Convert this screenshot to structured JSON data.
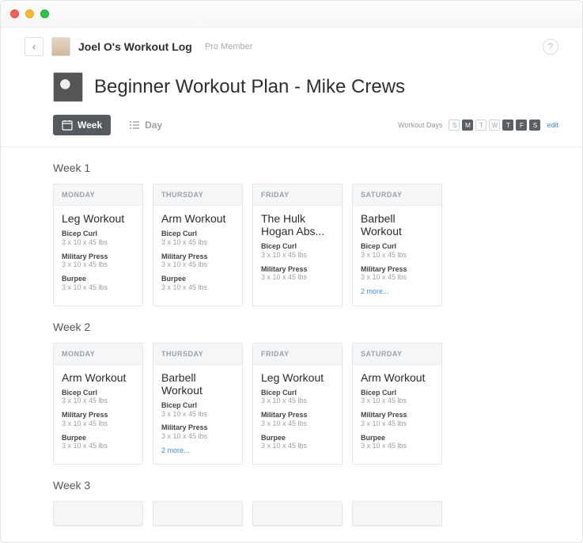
{
  "window": {
    "traffic_lights": [
      "red",
      "yellow",
      "green"
    ]
  },
  "header": {
    "back_glyph": "‹",
    "title": "Joel O's Workout Log",
    "subtitle": "Pro Member",
    "help_glyph": "?"
  },
  "plan": {
    "title": "Beginner Workout Plan - Mike Crews"
  },
  "toolbar": {
    "week_label": "Week",
    "day_label": "Day",
    "workout_days_label": "Workout Days",
    "edit_label": "edit",
    "days": [
      {
        "letter": "S",
        "on": false
      },
      {
        "letter": "M",
        "on": true
      },
      {
        "letter": "T",
        "on": false
      },
      {
        "letter": "W",
        "on": false
      },
      {
        "letter": "T",
        "on": true
      },
      {
        "letter": "F",
        "on": true
      },
      {
        "letter": "S",
        "on": true
      }
    ]
  },
  "weeks": [
    {
      "label": "Week 1",
      "cards": [
        {
          "day": "MONDAY",
          "title": "Leg Workout",
          "exercises": [
            {
              "name": "Bicep Curl",
              "sets": "3 x 10 x 45 lbs"
            },
            {
              "name": "Military Press",
              "sets": "3 x 10 x 45 lbs"
            },
            {
              "name": "Burpee",
              "sets": "3 x 10 x 45 lbs"
            }
          ],
          "more": null
        },
        {
          "day": "THURSDAY",
          "title": "Arm Workout",
          "exercises": [
            {
              "name": "Bicep Curl",
              "sets": "3 x 10 x 45 lbs"
            },
            {
              "name": "Military Press",
              "sets": "3 x 10 x 45 lbs"
            },
            {
              "name": "Burpee",
              "sets": "3 x 10 x 45 lbs"
            }
          ],
          "more": null
        },
        {
          "day": "FRIDAY",
          "title": "The Hulk Hogan Abs...",
          "exercises": [
            {
              "name": "Bicep Curl",
              "sets": "3 x 10 x 45 lbs"
            },
            {
              "name": "Military Press",
              "sets": "3 x 10 x 45 lbs"
            }
          ],
          "more": null
        },
        {
          "day": "SATURDAY",
          "title": "Barbell Workout",
          "exercises": [
            {
              "name": "Bicep Curl",
              "sets": "3 x 10 x 45 lbs"
            },
            {
              "name": "Military Press",
              "sets": "3 x 10 x 45 lbs"
            }
          ],
          "more": "2 more..."
        }
      ]
    },
    {
      "label": "Week 2",
      "cards": [
        {
          "day": "MONDAY",
          "title": "Arm Workout",
          "exercises": [
            {
              "name": "Bicep Curl",
              "sets": "3 x 10 x 45 lbs"
            },
            {
              "name": "Military Press",
              "sets": "3 x 10 x 45 lbs"
            },
            {
              "name": "Burpee",
              "sets": "3 x 10 x 45 lbs"
            }
          ],
          "more": null
        },
        {
          "day": "THURSDAY",
          "title": "Barbell Workout",
          "exercises": [
            {
              "name": "Bicep Curl",
              "sets": "3 x 10 x 45 lbs"
            },
            {
              "name": "Military Press",
              "sets": "3 x 10 x 45 lbs"
            }
          ],
          "more": "2 more..."
        },
        {
          "day": "FRIDAY",
          "title": "Leg Workout",
          "exercises": [
            {
              "name": "Bicep Curl",
              "sets": "3 x 10 x 45 lbs"
            },
            {
              "name": "Military Press",
              "sets": "3 x 10 x 45 lbs"
            },
            {
              "name": "Burpee",
              "sets": "3 x 10 x 45 lbs"
            }
          ],
          "more": null
        },
        {
          "day": "SATURDAY",
          "title": "Arm Workout",
          "exercises": [
            {
              "name": "Bicep Curl",
              "sets": "3 x 10 x 45 lbs"
            },
            {
              "name": "Military Press",
              "sets": "3 x 10 x 45 lbs"
            },
            {
              "name": "Burpee",
              "sets": "3 x 10 x 45 lbs"
            }
          ],
          "more": null
        }
      ]
    },
    {
      "label": "Week 3",
      "cards": [
        {
          "day": "",
          "title": "",
          "exercises": [],
          "more": null,
          "skeleton": true
        },
        {
          "day": "",
          "title": "",
          "exercises": [],
          "more": null,
          "skeleton": true
        },
        {
          "day": "",
          "title": "",
          "exercises": [],
          "more": null,
          "skeleton": true
        },
        {
          "day": "",
          "title": "",
          "exercises": [],
          "more": null,
          "skeleton": true
        }
      ]
    }
  ]
}
